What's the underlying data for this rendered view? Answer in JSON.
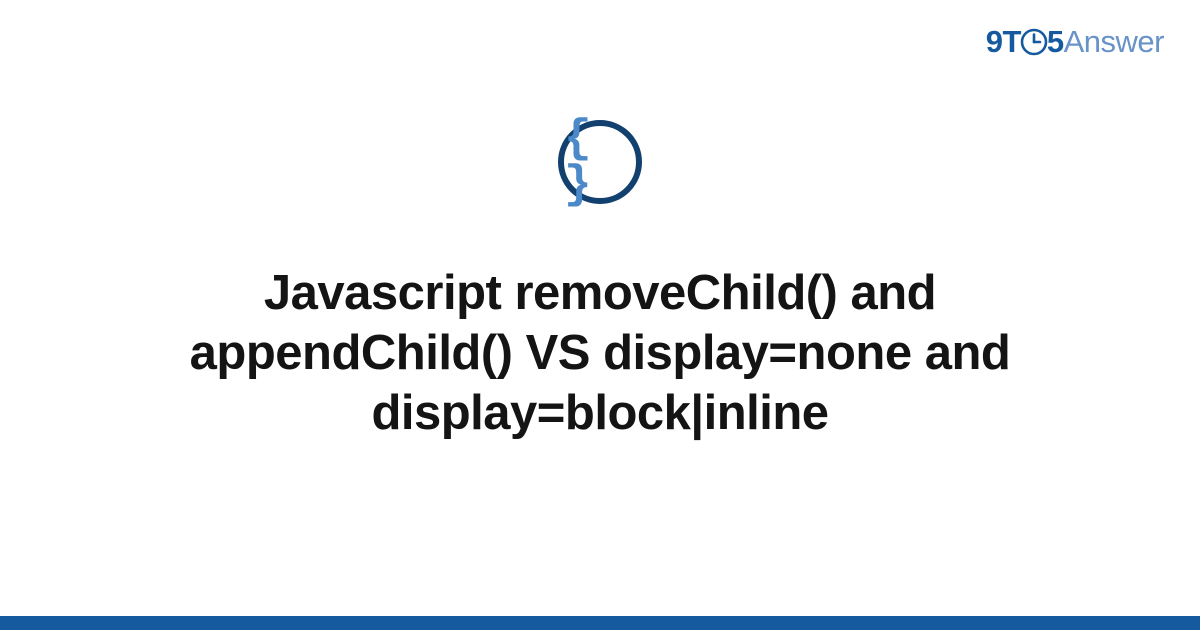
{
  "brand": {
    "part1": "9",
    "part2": "T",
    "part3": "5",
    "part4": "Answer"
  },
  "icon": {
    "name": "code-braces-icon",
    "glyph": "{ }"
  },
  "title": "Javascript removeChild() and appendChild() VS display=none and display=block|inline",
  "colors": {
    "brand_primary": "#155a9f",
    "brand_secondary": "#6893c9",
    "icon_ring": "#12406f",
    "icon_glyph": "#4b89c8",
    "title_text": "#141414",
    "bottom_bar": "#155a9f"
  }
}
